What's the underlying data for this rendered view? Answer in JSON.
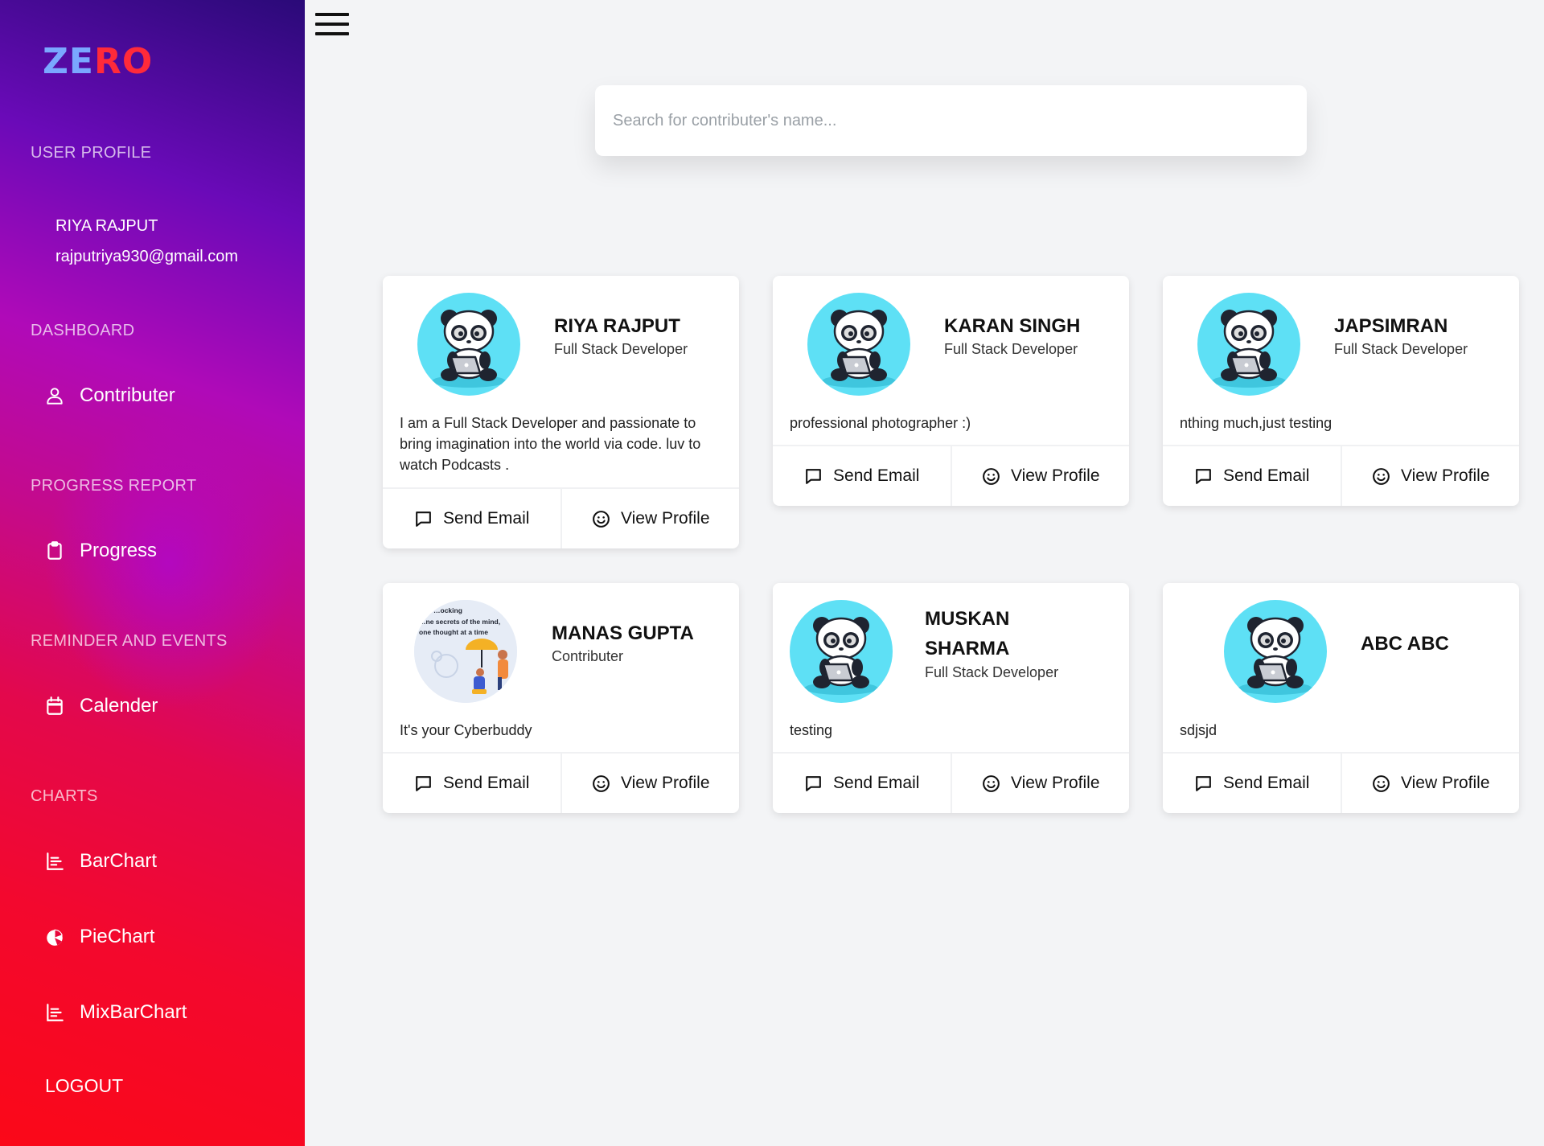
{
  "app": {
    "logo_part1": "ZE",
    "logo_part2": "RO"
  },
  "sidebar": {
    "user_profile_heading": "USER PROFILE",
    "user_name": "RIYA  RAJPUT",
    "user_email": "rajputriya930@gmail.com",
    "dashboard_heading": "DASHBOARD",
    "contributer_label": "Contributer",
    "progress_heading": "PROGRESS REPORT",
    "progress_label": "Progress",
    "reminder_heading": "REMINDER AND EVENTS",
    "calender_label": "Calender",
    "charts_heading": "CHARTS",
    "barchart_label": "BarChart",
    "piechart_label": "PieChart",
    "mixbarchart_label": "MixBarChart",
    "logout_label": "LOGOUT"
  },
  "search": {
    "placeholder": "Search for contributer's name..."
  },
  "cards": [
    {
      "name": "RIYA RAJPUT",
      "role": "Full Stack Developer",
      "bio": "I am a Full Stack Developer and passionate to bring imagination into the world via code. luv to watch Podcasts .",
      "avatar": "panda-avatar",
      "send_email": "Send Email",
      "view_profile": "View Profile"
    },
    {
      "name": "KARAN SINGH",
      "role": "Full Stack Developer",
      "bio": "professional photographer :)",
      "avatar": "panda-avatar",
      "send_email": "Send Email",
      "view_profile": "View Profile"
    },
    {
      "name": "JAPSIMRAN",
      "role": "Full Stack Developer",
      "bio": "nthing much,just testing",
      "avatar": "panda-avatar",
      "send_email": "Send Email",
      "view_profile": "View Profile"
    },
    {
      "name": "MANAS GUPTA",
      "role": "Contributer",
      "bio": "It's your Cyberbuddy",
      "avatar": "illustration-avatar",
      "avatar_text_1": "…ocking",
      "avatar_text_2": "…ne secrets of the mind,",
      "avatar_text_3": "one thought at a time",
      "send_email": "Send Email",
      "view_profile": "View Profile"
    },
    {
      "name": "MUSKAN SHARMA",
      "name_line1": "MUSKAN",
      "name_line2": "SHARMA",
      "role": "Full Stack Developer",
      "bio": "testing",
      "avatar": "panda-avatar",
      "send_email": "Send Email",
      "view_profile": "View Profile"
    },
    {
      "name": "ABC ABC",
      "role": "",
      "bio": "sdjsjd",
      "avatar": "panda-avatar",
      "send_email": "Send Email",
      "view_profile": "View Profile"
    }
  ],
  "colors": {
    "avatar_bg": "#5ee0f5",
    "logo_blue": "#7aa7ff",
    "logo_red": "#ff2a3a",
    "page_bg": "#f3f4f6"
  }
}
